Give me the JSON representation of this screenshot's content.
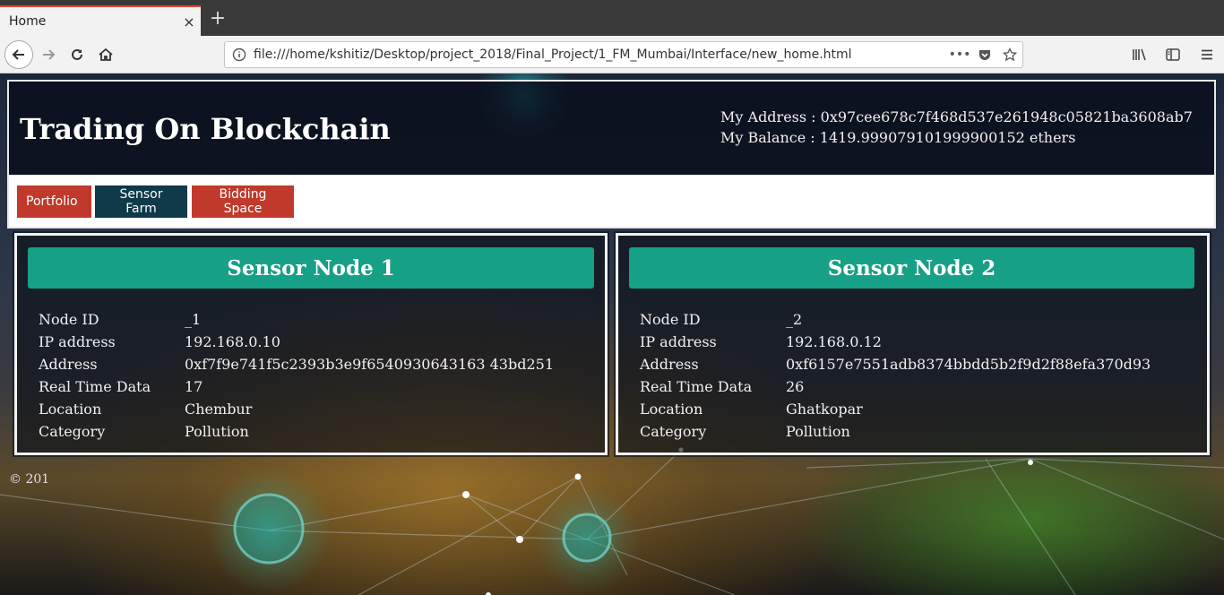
{
  "browser": {
    "tab_title": "Home",
    "tab_close": "×",
    "new_tab": "+",
    "url": "file:///home/kshitiz/Desktop/project_2018/Final_Project/1_FM_Mumbai/Interface/new_home.html",
    "url_more": "•••"
  },
  "header": {
    "title": "Trading On Blockchain",
    "address_line": "My Address : 0x97cee678c7f468d537e261948c05821ba3608ab7",
    "balance_line": "My Balance : 1419.999079101999900152 ethers"
  },
  "menu": {
    "portfolio": "Portfolio",
    "sensor_farm": "Sensor Farm",
    "bidding_space": "Bidding Space"
  },
  "labels": {
    "node_id": "Node ID",
    "ip": "IP address",
    "address": "Address",
    "realtime": "Real Time Data",
    "location": "Location",
    "category": "Category"
  },
  "nodes": [
    {
      "title": "Sensor Node 1",
      "node_id": "_1",
      "ip": "192.168.0.10",
      "address": "0xf7f9e741f5c2393b3e9f6540930643163 43bd251",
      "realtime": "17",
      "location": "Chembur",
      "category": "Pollution"
    },
    {
      "title": "Sensor Node 2",
      "node_id": "_2",
      "ip": "192.168.0.12",
      "address": "0xf6157e7551adb8374bbdd5b2f9d2f88efa370d93",
      "realtime": "26",
      "location": "Ghatkopar",
      "category": "Pollution"
    }
  ],
  "footer": {
    "copyright": "© 201"
  }
}
